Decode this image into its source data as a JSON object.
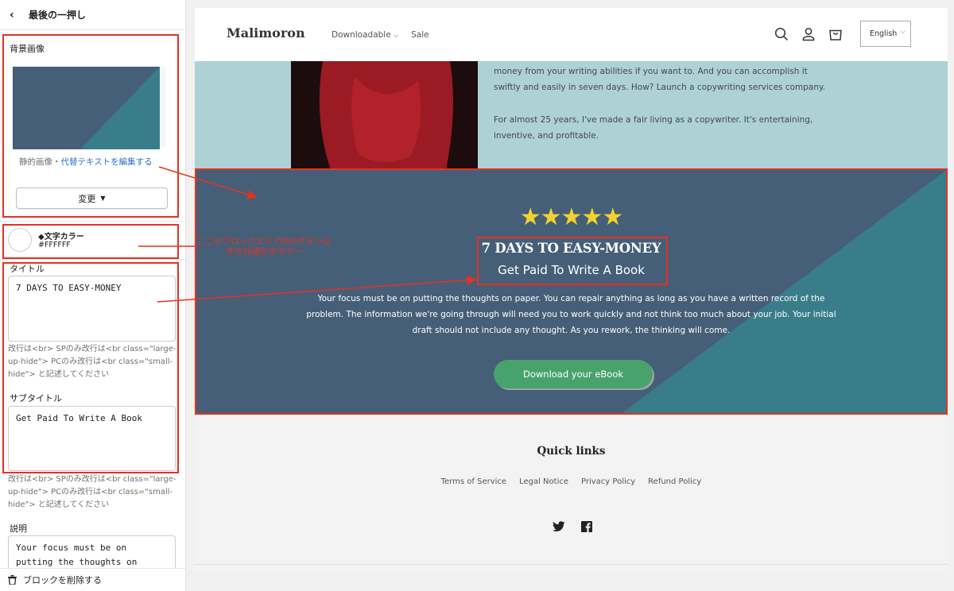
{
  "sidebar": {
    "header_title": "最後の一押し",
    "bg_label": "背景画像",
    "image_kind": "静的画像",
    "image_sep": "・",
    "edit_alt_link": "代替テキストを編集する",
    "change_btn": "変更",
    "text_color_title": "◆文字カラー",
    "text_color_value": "#FFFFFF",
    "title_label": "タイトル",
    "title_value": "7 DAYS TO EASY-MONEY",
    "title_hint": "改行は<br> SPのみ改行は<br class=\"large-up-hide\"> PCのみ改行は<br class=\"small-hide\"> と記述してください",
    "subtitle_label": "サブタイトル",
    "subtitle_value": "Get Paid To Write A Book",
    "subtitle_hint": "改行は<br> SPのみ改行は<br class=\"large-up-hide\"> PCのみ改行は<br class=\"small-hide\"> と記述してください",
    "desc_label": "説明",
    "desc_value": "Your focus must be on putting the thoughts on",
    "delete_block": "ブロックを削除する"
  },
  "annotation": "ここのブロックエリア内のボタン以外の共通文字カラー",
  "site": {
    "logo": "Malimoron",
    "nav": [
      "Downloadable",
      "Sale"
    ],
    "lang": "English",
    "about_p1": "money from your writing abilities if you want to. And you can accomplish it swiftly and easily in seven days. How? Launch a copywriting services company.",
    "about_p2": "For almost 25 years, I've made a fair living as a copywriter. It's entertaining, inventive, and profitable.",
    "cta_stars": "★★★★★",
    "cta_title": "7 DAYS TO EASY-MONEY",
    "cta_subtitle": "Get Paid To Write A Book",
    "cta_desc": "Your focus must be on putting the thoughts on paper. You can repair anything as long as you have a written record of the problem. The information we're going through will need you to work quickly and not think too much about your job. Your initial draft should not include any thought. As you rework, the thinking will come.",
    "cta_button": "Download your eBook",
    "footer_title": "Quick links",
    "footer_links": [
      "Terms of Service",
      "Legal Notice",
      "Privacy Policy",
      "Refund Policy"
    ]
  },
  "colors": {
    "cta_bg": "#465f78",
    "cta_accent": "#3a7d8a",
    "about_bg": "#aed1d5",
    "button_green": "#48a26c",
    "annotation_red": "#e8301f"
  }
}
